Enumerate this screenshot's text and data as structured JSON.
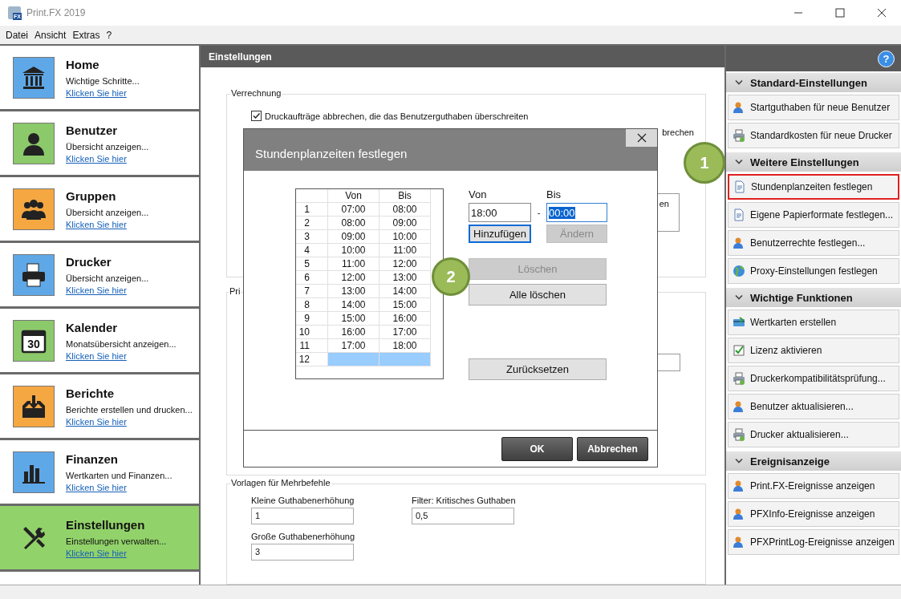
{
  "window": {
    "title": "Print.FX 2019",
    "app_icon_label": "FX"
  },
  "menu": [
    "Datei",
    "Ansicht",
    "Extras",
    "?"
  ],
  "nav": [
    {
      "title": "Home",
      "subtitle": "Wichtige Schritte...",
      "link": "Klicken Sie hier",
      "color": "#5fa8e8",
      "selected": false
    },
    {
      "title": "Benutzer",
      "subtitle": "Übersicht anzeigen...",
      "link": "Klicken Sie hier",
      "color": "#8cc96a",
      "selected": false
    },
    {
      "title": "Gruppen",
      "subtitle": "Übersicht anzeigen...",
      "link": "Klicken Sie hier",
      "color": "#f5a742",
      "selected": false
    },
    {
      "title": "Drucker",
      "subtitle": "Übersicht anzeigen...",
      "link": "Klicken Sie hier",
      "color": "#5fa8e8",
      "selected": false
    },
    {
      "title": "Kalender",
      "subtitle": "Monatsübersicht anzeigen...",
      "link": "Klicken Sie hier",
      "color": "#8cc96a",
      "icon_label": "30",
      "selected": false
    },
    {
      "title": "Berichte",
      "subtitle": "Berichte erstellen und drucken...",
      "link": "Klicken Sie hier",
      "color": "#f5a742",
      "selected": false
    },
    {
      "title": "Finanzen",
      "subtitle": "Wertkarten und Finanzen...",
      "link": "Klicken Sie hier",
      "color": "#5fa8e8",
      "selected": false
    },
    {
      "title": "Einstellungen",
      "subtitle": "Einstellungen verwalten...",
      "link": "Klicken Sie hier",
      "selected": true
    }
  ],
  "content": {
    "title": "Einstellungen",
    "verrechnung": {
      "legend": "Verrechnung",
      "checkbox": {
        "label": "Druckaufträge abbrechen, die das Benutzerguthaben überschreiten",
        "checked": true
      },
      "fragment_1": "brechen",
      "fragment_2": "en"
    },
    "section_2": {
      "legend": "Pri"
    },
    "vorlagen": {
      "legend": "Vorlagen für Mehrbefehle",
      "fields": [
        {
          "label": "Kleine Guthabenerhöhung",
          "value": "1"
        },
        {
          "label": "Filter: Kritisches Guthaben",
          "value": "0,5"
        },
        {
          "label": "Große Guthabenerhöhung",
          "value": "3"
        }
      ]
    }
  },
  "right_panel": {
    "help": "?",
    "sections": [
      {
        "title": "Standard-Einstellungen",
        "items": [
          {
            "label": "Startguthaben für neue Benutzer",
            "highlighted": false
          },
          {
            "label": "Standardkosten für neue Drucker",
            "highlighted": false
          }
        ]
      },
      {
        "title": "Weitere Einstellungen",
        "items": [
          {
            "label": "Stundenplanzeiten festlegen",
            "highlighted": true
          },
          {
            "label": "Eigene Papierformate festlegen...",
            "highlighted": false
          },
          {
            "label": "Benutzerrechte festlegen...",
            "highlighted": false
          },
          {
            "label": "Proxy-Einstellungen festlegen",
            "highlighted": false
          }
        ]
      },
      {
        "title": "Wichtige Funktionen",
        "items": [
          {
            "label": "Wertkarten erstellen",
            "highlighted": false
          },
          {
            "label": "Lizenz aktivieren",
            "highlighted": false
          },
          {
            "label": "Druckerkompatibilitätsprüfung...",
            "highlighted": false
          },
          {
            "label": "Benutzer aktualisieren...",
            "highlighted": false
          },
          {
            "label": "Drucker aktualisieren...",
            "highlighted": false
          }
        ]
      },
      {
        "title": "Ereignisanzeige",
        "items": [
          {
            "label": "Print.FX-Ereignisse anzeigen",
            "highlighted": false
          },
          {
            "label": "PFXInfo-Ereignisse anzeigen",
            "highlighted": false
          },
          {
            "label": "PFXPrintLog-Ereignisse anzeigen",
            "highlighted": false
          }
        ]
      }
    ]
  },
  "dialog": {
    "title": "Stundenplanzeiten festlegen",
    "table": {
      "columns": [
        "Von",
        "Bis"
      ],
      "rows": [
        {
          "number": "1",
          "from": "07:00",
          "to": "08:00",
          "selected": false
        },
        {
          "number": "2",
          "from": "08:00",
          "to": "09:00",
          "selected": false
        },
        {
          "number": "3",
          "from": "09:00",
          "to": "10:00",
          "selected": false
        },
        {
          "number": "4",
          "from": "10:00",
          "to": "11:00",
          "selected": false
        },
        {
          "number": "5",
          "from": "11:00",
          "to": "12:00",
          "selected": false
        },
        {
          "number": "6",
          "from": "12:00",
          "to": "13:00",
          "selected": false
        },
        {
          "number": "7",
          "from": "13:00",
          "to": "14:00",
          "selected": false
        },
        {
          "number": "8",
          "from": "14:00",
          "to": "15:00",
          "selected": false
        },
        {
          "number": "9",
          "from": "15:00",
          "to": "16:00",
          "selected": false
        },
        {
          "number": "10",
          "from": "16:00",
          "to": "17:00",
          "selected": false
        },
        {
          "number": "11",
          "from": "17:00",
          "to": "18:00",
          "selected": false
        },
        {
          "number": "12",
          "selected": true
        }
      ]
    },
    "from_field": {
      "label": "Von",
      "value": "18:00",
      "focused": false
    },
    "separator": "-",
    "to_field": {
      "label": "Bis",
      "value": "00:00",
      "focused": true
    },
    "add_button": {
      "label": "Hinzufügen",
      "focused": true,
      "disabled": false
    },
    "change_button": {
      "label": "Ändern",
      "focused": false,
      "disabled": true
    },
    "buttons": [
      {
        "label": "Löschen",
        "disabled": true
      },
      {
        "label": "Alle löschen",
        "disabled": false
      },
      {
        "label": "Zurücksetzen",
        "disabled": false
      }
    ],
    "footer_buttons": [
      "OK",
      "Abbrechen"
    ]
  },
  "callouts": [
    {
      "label": "1"
    },
    {
      "label": "2"
    }
  ]
}
